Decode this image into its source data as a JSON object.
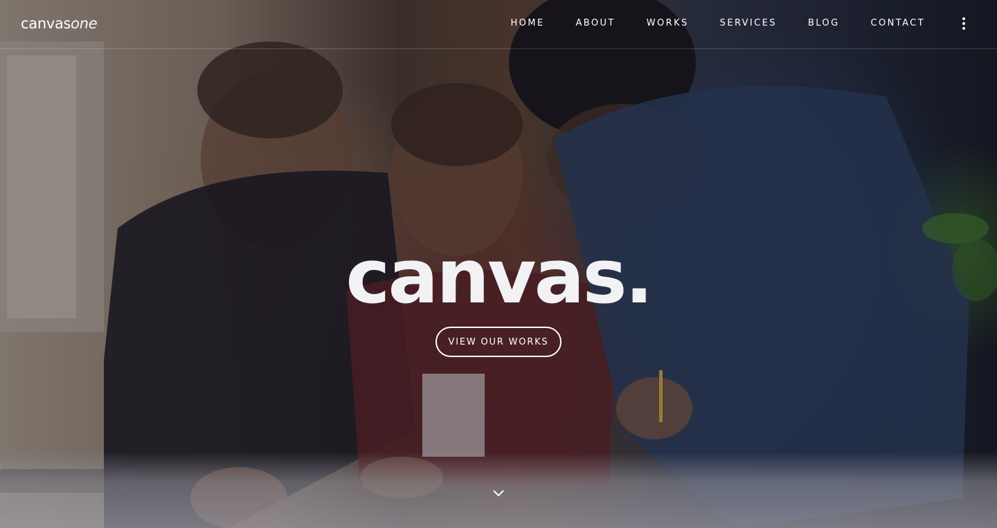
{
  "header": {
    "logo_bold": "canvas",
    "logo_light": "one",
    "nav": [
      {
        "label": "HOME"
      },
      {
        "label": "ABOUT"
      },
      {
        "label": "WORKS"
      },
      {
        "label": "SERVICES"
      },
      {
        "label": "BLOG"
      },
      {
        "label": "CONTACT"
      }
    ],
    "more_icon": "vertical-ellipsis-icon"
  },
  "hero": {
    "title": "canvas.",
    "cta_label": "VIEW OUR WORKS",
    "scroll_icon": "chevron-down-icon",
    "background_image": "three people looking at papers on a table"
  },
  "colors": {
    "text": "#ffffff",
    "title": "#f2f2f4"
  }
}
